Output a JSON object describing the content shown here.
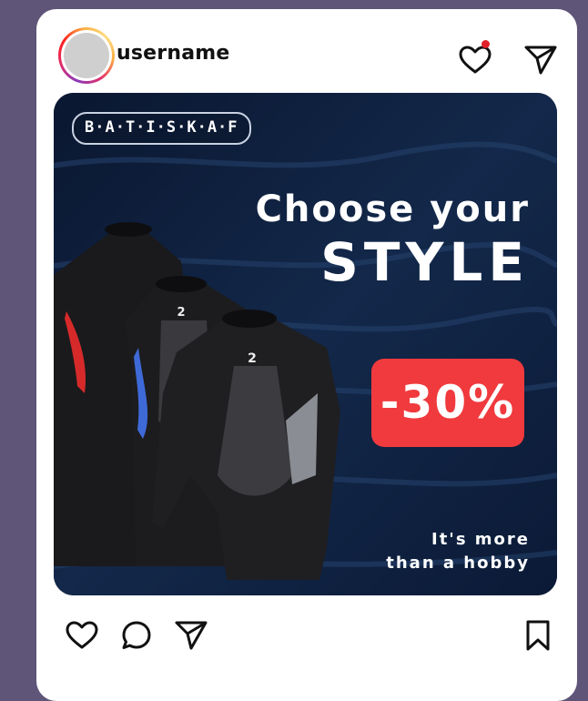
{
  "post": {
    "username": "username"
  },
  "banner": {
    "brand": "B·A·T·I·S·K·A·F",
    "headline_line1": "Choose your",
    "headline_line2": "STYLE",
    "discount": "-30%",
    "subline1": "It's more",
    "subline2": "than a hobby"
  },
  "colors": {
    "background": "#5f5578",
    "banner_bg": "#0c1a33",
    "discount_bg": "#f03a3d",
    "notification_dot": "#e0202a"
  },
  "icons": {
    "header": [
      "heart-icon",
      "send-icon"
    ],
    "footer": [
      "like-icon",
      "comment-icon",
      "share-icon",
      "bookmark-icon"
    ]
  }
}
